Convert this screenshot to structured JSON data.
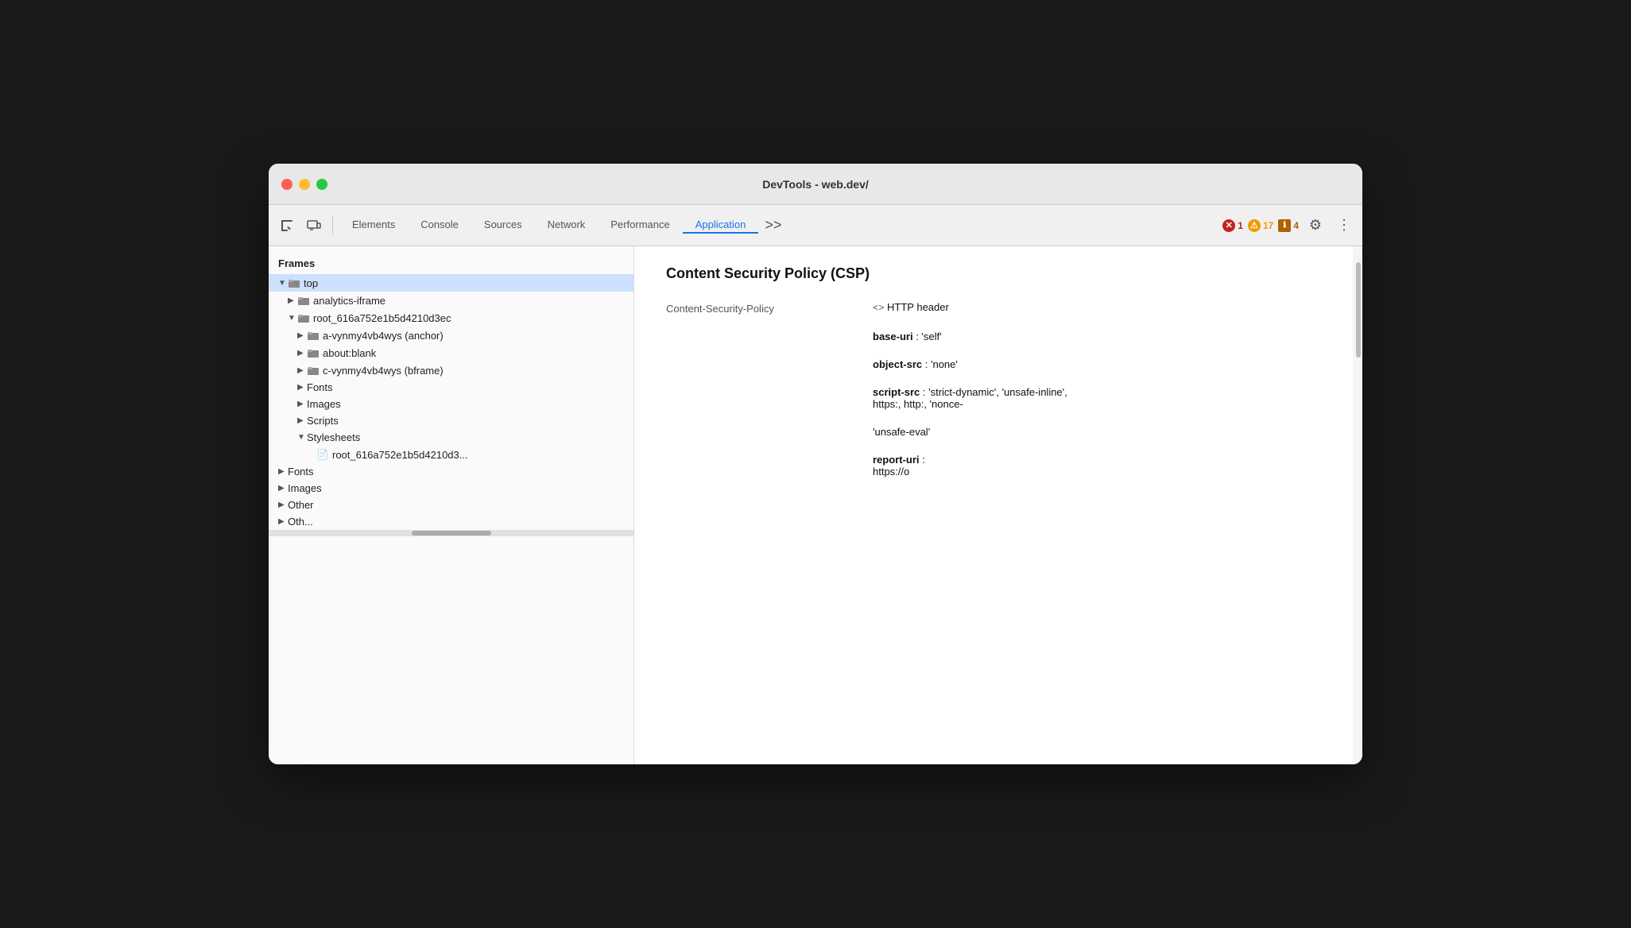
{
  "window": {
    "title": "DevTools - web.dev/"
  },
  "toolbar": {
    "inspect_label": "Inspect",
    "responsive_label": "Responsive",
    "tabs": [
      {
        "id": "elements",
        "label": "Elements",
        "active": false
      },
      {
        "id": "console",
        "label": "Console",
        "active": false
      },
      {
        "id": "sources",
        "label": "Sources",
        "active": false
      },
      {
        "id": "network",
        "label": "Network",
        "active": false
      },
      {
        "id": "performance",
        "label": "Performance",
        "active": false
      },
      {
        "id": "application",
        "label": "Application",
        "active": true
      }
    ],
    "more_tabs_label": ">>",
    "errors": {
      "count": "1",
      "icon": "✕"
    },
    "warnings": {
      "count": "17",
      "icon": "⚠"
    },
    "info": {
      "count": "4",
      "icon": "ℹ"
    },
    "settings_icon": "⚙",
    "more_options_icon": "⋮"
  },
  "sidebar": {
    "section_label": "Frames",
    "items": [
      {
        "id": "top",
        "label": "top",
        "indent": 0,
        "type": "folder",
        "expanded": true,
        "selected": true
      },
      {
        "id": "analytics-iframe",
        "label": "analytics-iframe",
        "indent": 1,
        "type": "folder",
        "expanded": false
      },
      {
        "id": "root-frame",
        "label": "root_616a752e1b5d4210d3ec",
        "indent": 1,
        "type": "folder",
        "expanded": true
      },
      {
        "id": "a-anchor",
        "label": "a-vynmy4vb4wys (anchor)",
        "indent": 2,
        "type": "folder",
        "expanded": false
      },
      {
        "id": "about-blank",
        "label": "about:blank",
        "indent": 2,
        "type": "folder",
        "expanded": false
      },
      {
        "id": "c-bframe",
        "label": "c-vynmy4vb4wys (bframe)",
        "indent": 2,
        "type": "folder",
        "expanded": false
      },
      {
        "id": "fonts-sub",
        "label": "Fonts",
        "indent": 2,
        "type": "category",
        "expanded": false
      },
      {
        "id": "images-sub",
        "label": "Images",
        "indent": 2,
        "type": "category",
        "expanded": false
      },
      {
        "id": "scripts-sub",
        "label": "Scripts",
        "indent": 2,
        "type": "category",
        "expanded": false
      },
      {
        "id": "stylesheets-sub",
        "label": "Stylesheets",
        "indent": 2,
        "type": "category",
        "expanded": true
      },
      {
        "id": "stylesheet-file",
        "label": "root_616a752e1b5d4210d3...",
        "indent": 3,
        "type": "file"
      },
      {
        "id": "fonts-top",
        "label": "Fonts",
        "indent": 0,
        "type": "category",
        "expanded": false
      },
      {
        "id": "images-top",
        "label": "Images",
        "indent": 0,
        "type": "category",
        "expanded": false
      },
      {
        "id": "other-top",
        "label": "Other",
        "indent": 0,
        "type": "category",
        "expanded": false
      },
      {
        "id": "other2-top",
        "label": "Oth...",
        "indent": 0,
        "type": "category",
        "expanded": false
      }
    ]
  },
  "content": {
    "title": "Content Security Policy (CSP)",
    "label": "Content-Security-Policy",
    "source": "<> HTTP header",
    "directives": [
      {
        "id": "base-uri",
        "name": "base-uri",
        "value": ": 'self'"
      },
      {
        "id": "object-src",
        "name": "object-src",
        "value": ": 'none'"
      },
      {
        "id": "script-src",
        "name": "script-src",
        "value": ": 'strict-dynamic', 'unsafe-inline',"
      },
      {
        "id": "script-src-cont",
        "name": "",
        "value": "https:, http:, 'nonce-"
      },
      {
        "id": "unsafe-eval",
        "name": "",
        "value": "'unsafe-eval'"
      },
      {
        "id": "report-uri",
        "name": "report-uri",
        "value": ":"
      },
      {
        "id": "report-uri-cont",
        "name": "",
        "value": "https://o"
      }
    ]
  },
  "colors": {
    "active_tab": "#1a73e8",
    "selected_bg": "#cce0ff",
    "error_red": "#c5221f",
    "warning_yellow": "#f29900",
    "info_orange": "#b06000"
  }
}
